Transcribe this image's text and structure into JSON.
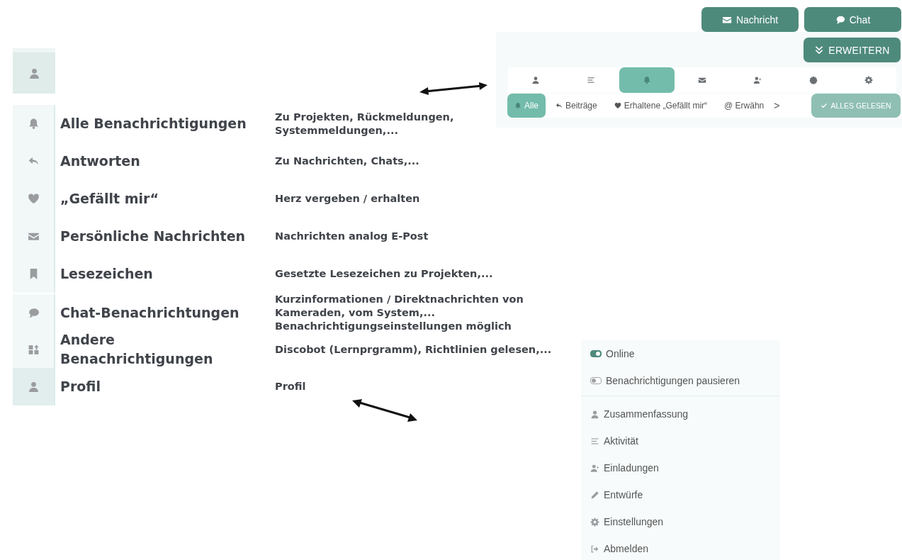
{
  "legend": {
    "top_icon": {
      "kind": "user",
      "selected": true
    },
    "rows": [
      {
        "kind": "bell",
        "title": "Alle Benachrichtigungen",
        "description": "Zu Projekten, Rückmeldungen, Systemmeldungen,...",
        "selected": false
      },
      {
        "kind": "reply",
        "title": "Antworten",
        "description": "Zu Nachrichten, Chats,...",
        "selected": false
      },
      {
        "kind": "heart",
        "title": "„Gefällt mir“",
        "description": "Herz vergeben / erhalten",
        "selected": false
      },
      {
        "kind": "envelope",
        "title": "Persönliche Nachrichten",
        "description": "Nachrichten analog E-Post",
        "selected": false
      },
      {
        "kind": "bookmark",
        "title": "Lesezeichen",
        "description": "Gesetzte Lesezeichen zu Projekten,...",
        "selected": false
      },
      {
        "kind": "chat",
        "title": "Chat-Benachrichtungen",
        "description": "Kurzinformationen / Direktnachrichten von Kameraden, vom System,... Benachrichtigungseinstellungen möglich",
        "selected": false
      },
      {
        "kind": "apps",
        "title": "Andere Benachrichtigungen",
        "description": "Discobot (Lernprgramm), Richtlinien gelesen,...",
        "selected": false
      },
      {
        "kind": "user",
        "title": "Profil",
        "description": "Profil",
        "selected": true
      }
    ]
  },
  "header_buttons": [
    {
      "kind": "envelope",
      "label": "Nachricht"
    },
    {
      "kind": "chat",
      "label": "Chat"
    }
  ],
  "expand_button": {
    "kind": "chevrons",
    "label": "ERWEITERN"
  },
  "tabs": [
    {
      "kind": "user",
      "selected": false
    },
    {
      "kind": "list",
      "selected": false
    },
    {
      "kind": "bell",
      "selected": true
    },
    {
      "kind": "envelope",
      "selected": false
    },
    {
      "kind": "user-plus",
      "selected": false
    },
    {
      "kind": "badge",
      "selected": false
    },
    {
      "kind": "gear",
      "selected": false
    }
  ],
  "filters": [
    {
      "kind": "bell",
      "label": "Alle",
      "selected": true
    },
    {
      "kind": "reply",
      "label": "Beiträge",
      "selected": false
    },
    {
      "kind": "heart",
      "label": "Erhaltene „Gefällt mir“",
      "selected": false
    },
    {
      "kind": "none",
      "label": "@ Erwähn",
      "selected": false
    }
  ],
  "filters_more": {
    "label": ">"
  },
  "mark_read": {
    "kind": "check",
    "label": "ALLES GELESEN",
    "disabled": true
  },
  "menu": {
    "toggles": [
      {
        "label": "Online",
        "on": true
      },
      {
        "label": "Benachrichtigungen pausieren",
        "on": false
      }
    ],
    "items": [
      {
        "kind": "user",
        "label": "Zusammenfassung"
      },
      {
        "kind": "list",
        "label": "Aktivität"
      },
      {
        "kind": "user-plus",
        "label": "Einladungen"
      },
      {
        "kind": "pencil",
        "label": "Entwürfe"
      },
      {
        "kind": "gear",
        "label": "Einstellungen"
      },
      {
        "kind": "signout",
        "label": "Abmelden"
      }
    ]
  }
}
